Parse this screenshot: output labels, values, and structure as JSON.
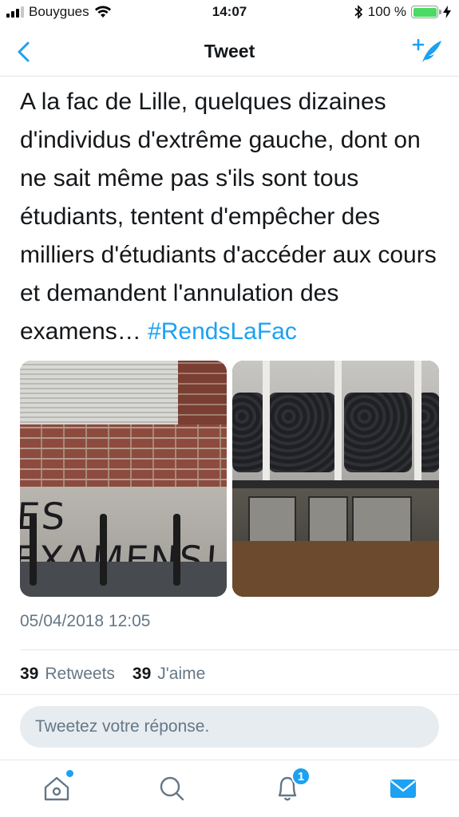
{
  "status_bar": {
    "carrier": "Bouygues",
    "time": "14:07",
    "battery_percent": "100 %",
    "battery_level": 1.0
  },
  "nav": {
    "title": "Tweet",
    "back_icon": "chevron-left-icon",
    "compose_icon": "compose-tweet-icon"
  },
  "tweet": {
    "text": "A la fac de Lille, quelques dizaines d'individus d'extrême gauche, dont on ne sait même pas s'ils sont tous étudiants, tentent d'empêcher des milliers d'étudiants d'accéder aux cours et demandent l'annulation des examens…",
    "hashtag": "#RendsLaFac",
    "photo1_graffiti": "ES EXAMENS!",
    "timestamp": "05/04/2018 12:05",
    "retweets_count": "39",
    "retweets_label": "Retweets",
    "likes_count": "39",
    "likes_label": "J'aime"
  },
  "reply": {
    "placeholder": "Tweetez votre réponse."
  },
  "tab_bar": {
    "notifications_badge": "1",
    "icons": [
      "home-icon",
      "search-icon",
      "notifications-icon",
      "messages-icon"
    ]
  },
  "colors": {
    "accent": "#1da1f2",
    "secondary_text": "#657786",
    "battery": "#4cd964"
  }
}
